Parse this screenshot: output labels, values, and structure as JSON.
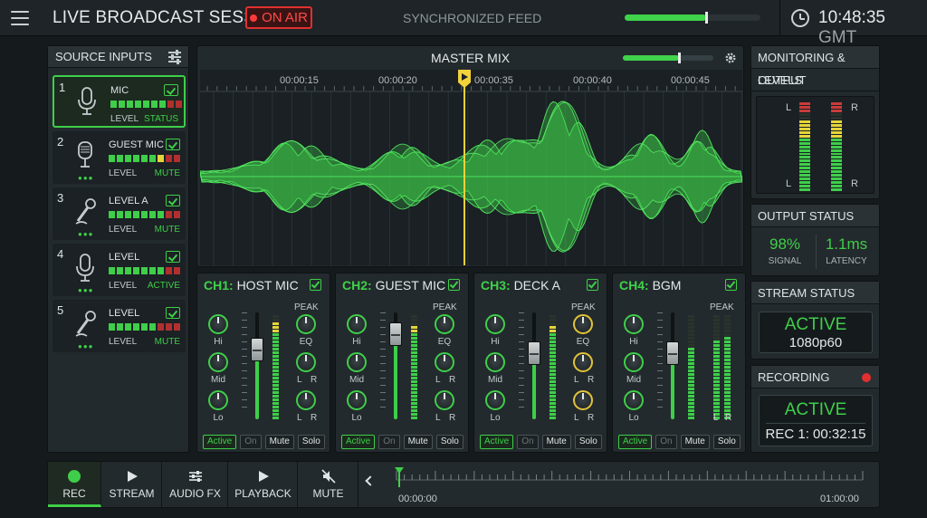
{
  "header": {
    "title": "LIVE BROADCAST SESSION",
    "on_air": "ON AIR",
    "sync_label": "SYNCHRONIZED FEED",
    "sync_level": 0.6,
    "time": "10:48:35",
    "tz": "GMT"
  },
  "sources": {
    "title": "SOURCE INPUTS",
    "items": [
      {
        "num": "1",
        "name": "MIC",
        "sub": "LEVEL",
        "status": "STATUS",
        "selected": true,
        "leds": [
          "g",
          "g",
          "g",
          "g",
          "g",
          "g",
          "g",
          "r",
          "r"
        ],
        "icon": "microphone-icon"
      },
      {
        "num": "2",
        "name": "GUEST MIC",
        "sub": "LEVEL",
        "status": "MUTE",
        "selected": false,
        "leds": [
          "g",
          "g",
          "g",
          "g",
          "g",
          "g",
          "y",
          "r",
          "r"
        ],
        "icon": "podcast-mic-icon"
      },
      {
        "num": "3",
        "name": "LEVEL A",
        "sub": "LEVEL",
        "status": "MUTE",
        "selected": false,
        "leds": [
          "g",
          "g",
          "g",
          "g",
          "g",
          "g",
          "g",
          "r",
          "r"
        ],
        "icon": "handheld-mic-icon"
      },
      {
        "num": "4",
        "name": "LEVEL",
        "sub": "LEVEL",
        "status": "ACTIVE",
        "selected": false,
        "leds": [
          "g",
          "g",
          "g",
          "g",
          "g",
          "g",
          "g",
          "r",
          "r"
        ],
        "icon": "microphone-icon"
      },
      {
        "num": "5",
        "name": "LEVEL",
        "sub": "LEVEL",
        "status": "MUTE",
        "selected": false,
        "leds": [
          "g",
          "g",
          "g",
          "g",
          "g",
          "g",
          "r",
          "r",
          "r"
        ],
        "icon": "handheld-mic-icon"
      }
    ]
  },
  "master": {
    "title": "MASTER MIX",
    "level": 0.62,
    "timestamps": [
      "00:00:15",
      "00:00:20",
      "00:00:35",
      "00:00:40",
      "00:00:45"
    ]
  },
  "channels": [
    {
      "id": "CH1:",
      "name": "HOST MIC",
      "peak": "PEAK",
      "knobs_left": [
        "Hi",
        "Mid",
        "Lo"
      ],
      "eq": "EQ",
      "lr": [
        "L",
        "R"
      ],
      "fader": 0.65,
      "meter_l": 0.95,
      "meter_r": 0.9,
      "buttons": [
        "Active",
        "On",
        "Mute",
        "Solo"
      ]
    },
    {
      "id": "CH2:",
      "name": "GUEST MIC",
      "peak": "PEAK",
      "knobs_left": [
        "Hi",
        "Mid",
        "Lo"
      ],
      "eq": "EQ",
      "lr": [
        "L",
        "R"
      ],
      "fader": 0.8,
      "meter_l": 0.92,
      "meter_r": 0.88,
      "buttons": [
        "Active",
        "On",
        "Mute",
        "Solo"
      ]
    },
    {
      "id": "CH3:",
      "name": "DECK A",
      "peak": "PEAK",
      "knobs_left": [
        "Hi",
        "Mid",
        "Lo"
      ],
      "eq": "EQ",
      "lr": [
        "L",
        "R"
      ],
      "fader": 0.62,
      "meter_l": 0.9,
      "meter_r": 0.93,
      "buttons": [
        "Active",
        "On",
        "Mute",
        "Solo"
      ]
    },
    {
      "id": "CH4:",
      "name": "BGM",
      "peak": "PEAK",
      "knobs_left": [
        "Hi",
        "Mid",
        "Lo"
      ],
      "eq": "EQ",
      "lr": [
        "L",
        "R"
      ],
      "fader": 0.62,
      "meter_l": 0.78,
      "meter_r": 0.82,
      "buttons": [
        "Active",
        "On",
        "Mute",
        "Solo"
      ]
    }
  ],
  "monitoring": {
    "title": "MONITORING & OUTPUT",
    "levels_title": "LEVELS",
    "l": "L",
    "r": "R",
    "level_l": 0.82,
    "level_r": 0.8
  },
  "output": {
    "title": "OUTPUT STATUS",
    "signal_val": "98%",
    "signal_lbl": "SIGNAL",
    "latency_val": "1.1ms",
    "latency_lbl": "LATENCY"
  },
  "stream": {
    "title": "STREAM STATUS",
    "state": "ACTIVE",
    "res": "1080p60"
  },
  "recording": {
    "title": "RECORDING",
    "state": "ACTIVE",
    "time": "REC 1: 00:32:15"
  },
  "toolbar": {
    "rec": "REC",
    "stream": "STREAM",
    "fx": "AUDIO FX",
    "playback": "PLAYBACK",
    "mute": "MUTE",
    "start": "00:00:00",
    "end": "01:00:00"
  },
  "colors": {
    "accent": "#3fce4a",
    "warn": "#e4d43a",
    "alert": "#e03030"
  }
}
